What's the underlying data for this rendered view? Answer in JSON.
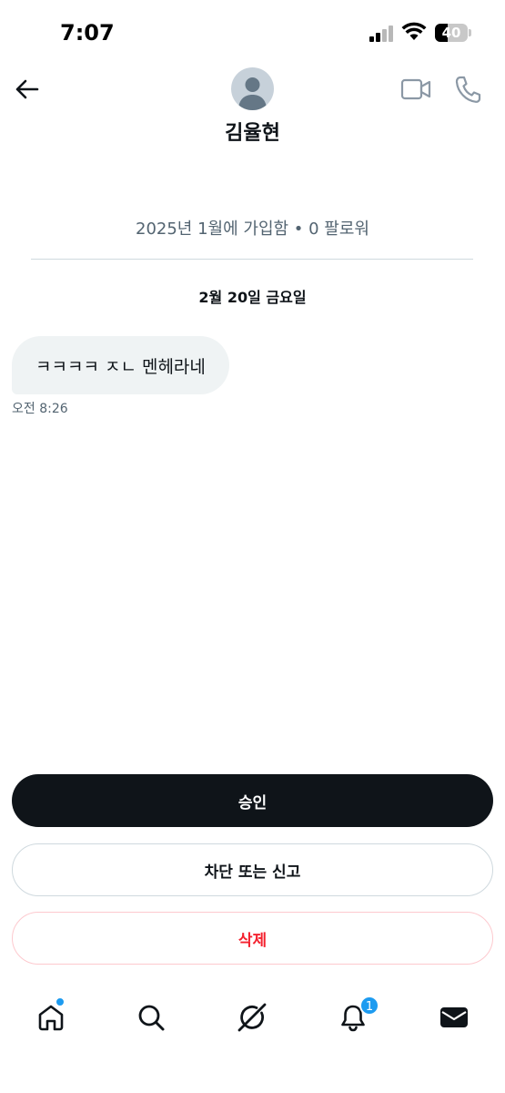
{
  "status_bar": {
    "time": "7:07",
    "battery_percent": 40,
    "battery_label": "40"
  },
  "header": {
    "name": "김율현",
    "icons": {
      "back": "arrow-left-icon",
      "video": "video-camera-icon",
      "call": "phone-icon"
    }
  },
  "profile": {
    "join_info": "2025년 1월에 가입함 • 0 팔로워"
  },
  "conversation": {
    "date": "2월 20일 금요일",
    "messages": [
      {
        "text": "ㅋㅋㅋㅋ ㅈㄴ 멘헤라네",
        "time": "오전 8:26"
      }
    ]
  },
  "actions": {
    "accept": "승인",
    "block_report": "차단 또는 신고",
    "delete": "삭제"
  },
  "nav": {
    "items": [
      "home-icon",
      "search-icon",
      "grok-icon",
      "bell-icon",
      "mail-icon"
    ],
    "notification_count": "1"
  },
  "colors": {
    "accent": "#1d9bf0",
    "dark": "#0f1419",
    "danger": "#f4212e",
    "secondary_text": "#536471"
  }
}
